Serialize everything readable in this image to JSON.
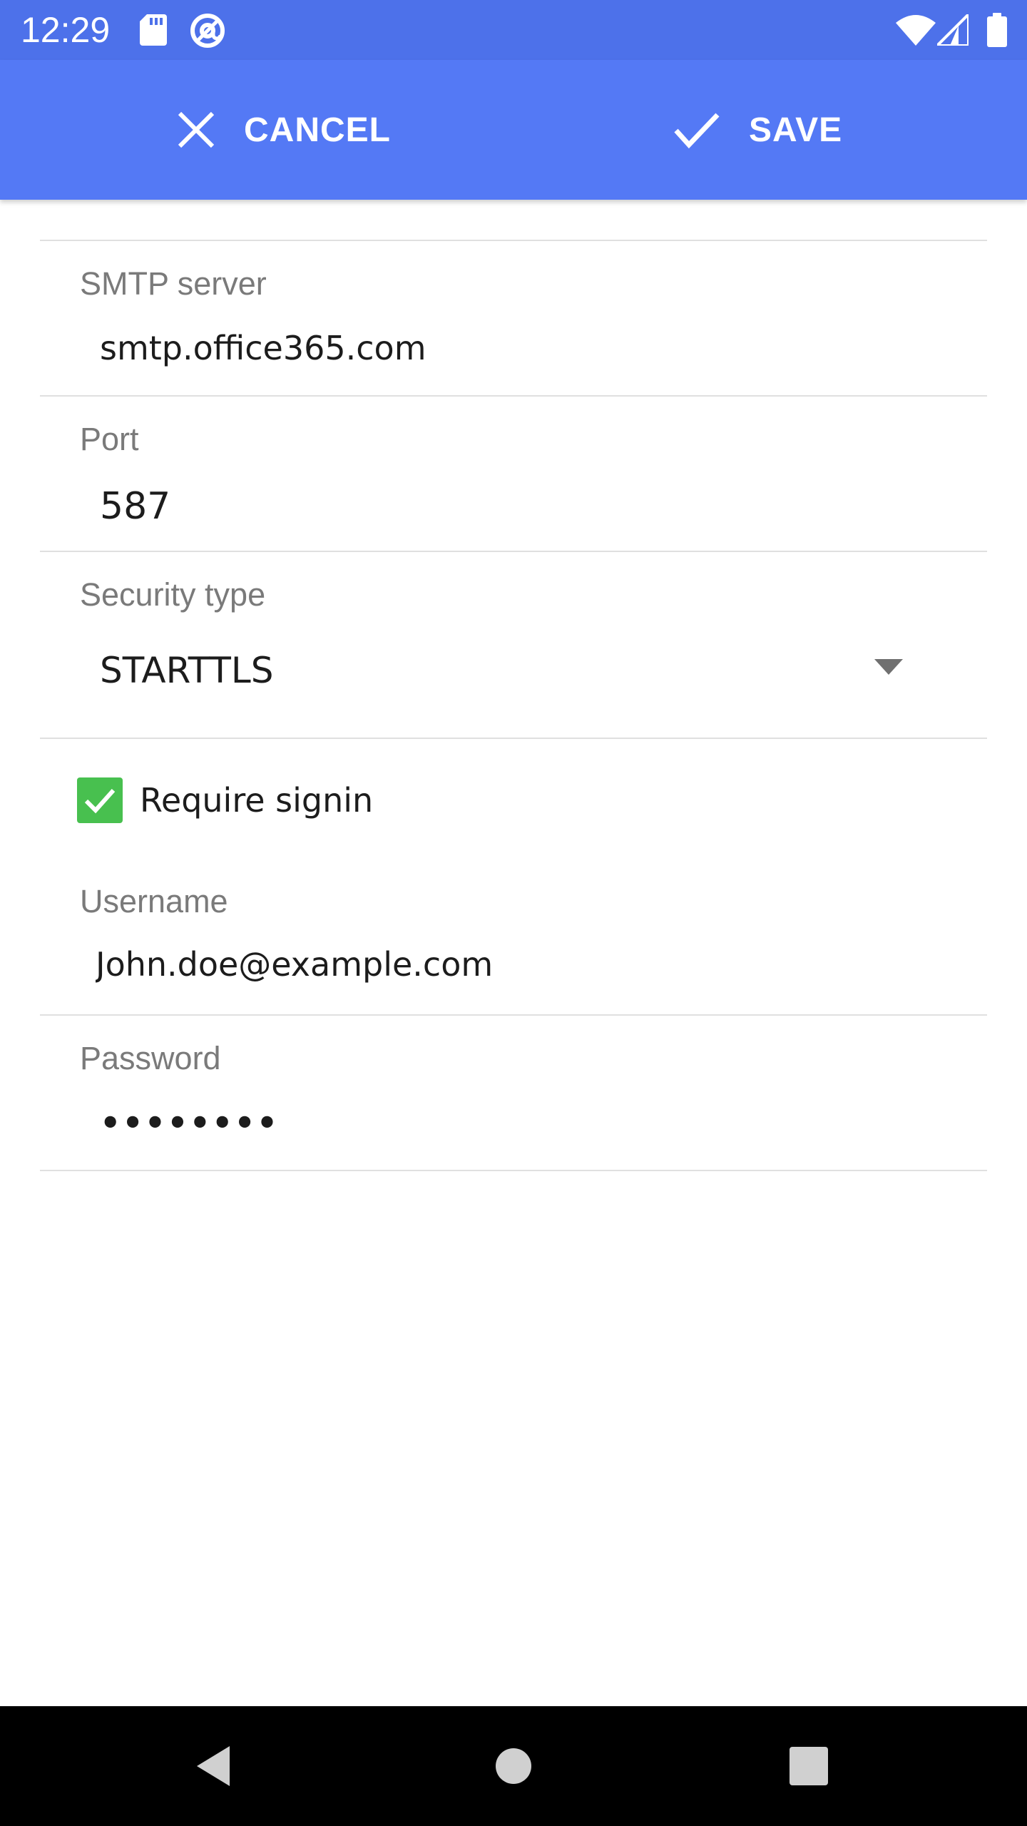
{
  "status_bar": {
    "time": "12:29",
    "left_icons": [
      "sd-card-icon",
      "at-sign-icon"
    ],
    "right_icons": [
      "wifi-icon",
      "signal-icon",
      "battery-icon"
    ]
  },
  "action_bar": {
    "cancel_label": "CANCEL",
    "save_label": "SAVE",
    "background": "#5479f5"
  },
  "form": {
    "smtp_server": {
      "label": "SMTP server",
      "value": "smtp.office365.com"
    },
    "port": {
      "label": "Port",
      "value": "587"
    },
    "security_type": {
      "label": "Security type",
      "value": "STARTTLS"
    },
    "require_signin": {
      "label": "Require signin",
      "checked": true
    },
    "username": {
      "label": "Username",
      "value": "John.doe@example.com"
    },
    "password": {
      "label": "Password",
      "value": "••••••••"
    }
  },
  "nav_bar": {
    "icons": [
      "back-icon",
      "home-icon",
      "recents-icon"
    ]
  },
  "colors": {
    "accent": "#5479f5",
    "status_bar": "#4d71ea",
    "checkbox": "#48c04f"
  }
}
